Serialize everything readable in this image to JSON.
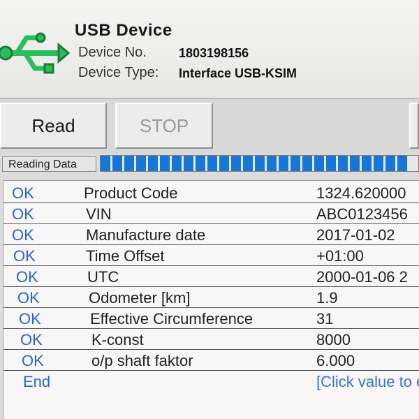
{
  "device": {
    "title": "USB Device",
    "number_label": "Device No.",
    "number_value": "1803198156",
    "type_label": "Device Type:",
    "type_value": "Interface USB-KSIM"
  },
  "toolbar": {
    "read_label": "Read",
    "stop_label": "STOP"
  },
  "status": {
    "label": "Reading Data",
    "progress_fraction": 0.97
  },
  "rows": [
    {
      "status": "OK",
      "name": "Product Code",
      "value": "1324.620000"
    },
    {
      "status": "OK",
      "name": "VIN",
      "value": "ABC0123456"
    },
    {
      "status": "OK",
      "name": "Manufacture date",
      "value": "2017-01-02"
    },
    {
      "status": "OK",
      "name": "Time Offset",
      "value": "+01:00"
    },
    {
      "status": "OK",
      "name": "UTC",
      "value": "2000-01-06 2"
    },
    {
      "status": "OK",
      "name": "Odometer [km]",
      "value": "1.9"
    },
    {
      "status": "OK",
      "name": "Effective Circumference",
      "value": "31"
    },
    {
      "status": "OK",
      "name": "K-const",
      "value": "8000"
    },
    {
      "status": "OK",
      "name": "o/p shaft faktor",
      "value": "6.000"
    },
    {
      "status": "End",
      "name": "",
      "value": "[Click value to e"
    }
  ],
  "colors": {
    "status_blue": "#2a63c7",
    "progress_blue": "#1677d6",
    "usb_green": "#2bbf5a"
  },
  "icons": {
    "usb": "usb-icon"
  }
}
